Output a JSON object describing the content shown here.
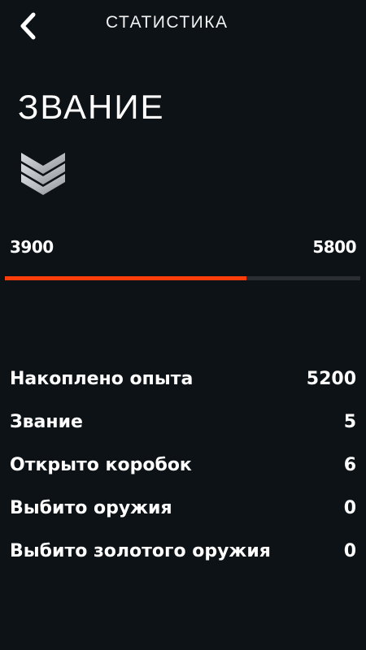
{
  "header": {
    "title": "СТАТИСТИКА",
    "back_icon": "chevron-left-icon"
  },
  "rank": {
    "heading": "ЗВАНИЕ",
    "icon": "rank-chevrons-icon"
  },
  "progress": {
    "min_label": "3900",
    "max_label": "5800",
    "fill_fraction": 0.68,
    "fill_color": "#ff3d0a",
    "track_color": "#2a2d31"
  },
  "stats": [
    {
      "label": "Накоплено опыта",
      "value": "5200"
    },
    {
      "label": "Звание",
      "value": "5"
    },
    {
      "label": "Открыто коробок",
      "value": "6"
    },
    {
      "label": "Выбито оружия",
      "value": "0"
    },
    {
      "label": "Выбито золотого оружия",
      "value": "0"
    }
  ],
  "colors": {
    "background": "#0d1217",
    "text": "#ffffff"
  }
}
